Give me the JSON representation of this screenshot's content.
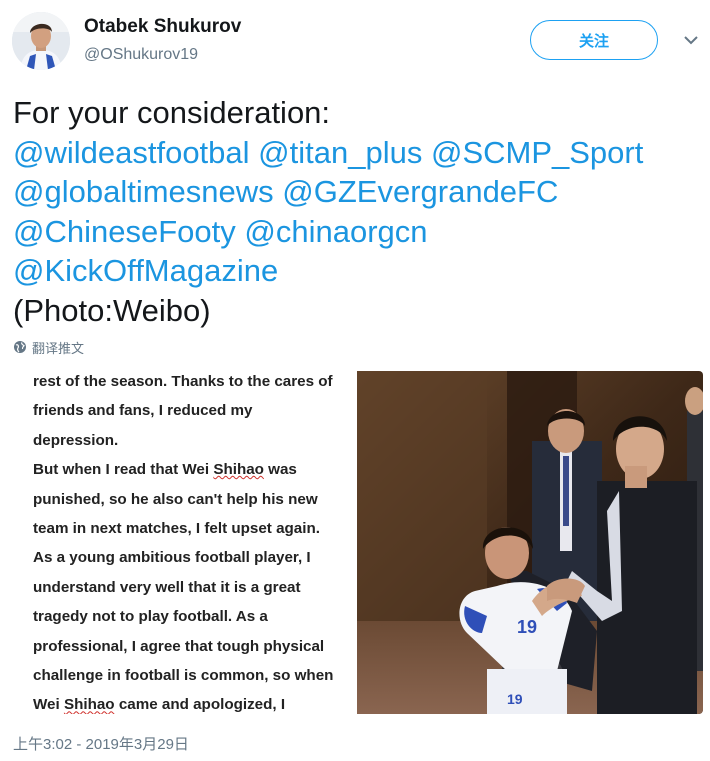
{
  "profile": {
    "name": "Otabek Shukurov",
    "handle": "@OShukurov19"
  },
  "follow_label": "关注",
  "tweet": {
    "intro": "For your consideration:",
    "mention_lines": [
      [
        "@wildeastfootbal",
        "@titan_plus",
        "@SCMP_Sport"
      ],
      [
        "@globaltimesnews",
        "@GZEvergrandeFC"
      ],
      [
        "@ChineseFooty",
        "@chinaorgcn"
      ],
      [
        "@KickOffMagazine"
      ]
    ],
    "credit": "(Photo:Weibo)"
  },
  "translate_label": "翻译推文",
  "article": {
    "lines": [
      "rest of the season. Thanks to the cares of",
      "friends and fans, I reduced my",
      "depression.",
      "But when I read that Wei Shihao was",
      "punished, so he also can't help his new",
      "team in next matches, I felt upset again.",
      "As a young ambitious football player, I",
      "understand very well that it is a great",
      "tragedy not to play football. As a",
      "professional, I agree that tough physical",
      "challenge in football is common, so when",
      "Wei Shihao came and apologized, I"
    ]
  },
  "photo": {
    "jersey_number": "19"
  },
  "timestamp": "上午3:02 - 2019年3月29日",
  "colors": {
    "link": "#1b95e0",
    "follow": "#1da1f2",
    "muted": "#657786"
  },
  "icons": [
    "avatar-photo",
    "chevron-down-icon",
    "globe-icon"
  ]
}
